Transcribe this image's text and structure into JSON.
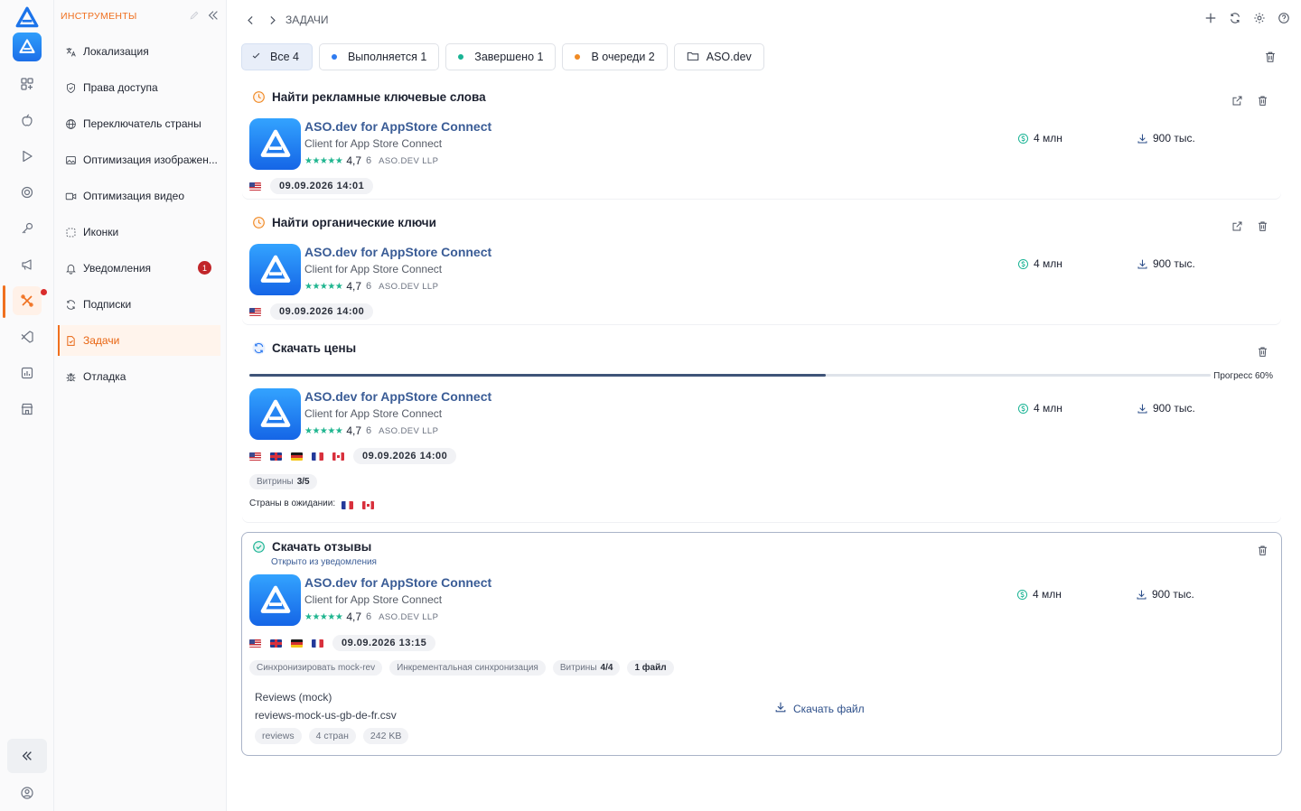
{
  "rail": {
    "icons": [
      "logo-icon",
      "app-logo-icon",
      "grid-icon",
      "apple-icon",
      "play-icon",
      "target-icon",
      "key-icon",
      "megaphone-icon",
      "tools-icon",
      "vscode-icon",
      "chart-icon",
      "store-icon"
    ],
    "active": "tools-icon",
    "bottom": [
      "collapse-icon",
      "user-icon"
    ]
  },
  "sidebar": {
    "title": "ИНСТРУМЕНТЫ",
    "items": [
      {
        "label": "Локализация",
        "icon": "translate-icon"
      },
      {
        "label": "Права доступа",
        "icon": "shield-icon"
      },
      {
        "label": "Переключатель страны",
        "icon": "globe-icon"
      },
      {
        "label": "Оптимизация изображен...",
        "icon": "image-icon"
      },
      {
        "label": "Оптимизация видео",
        "icon": "video-icon"
      },
      {
        "label": "Иконки",
        "icon": "icons-icon"
      },
      {
        "label": "Уведомления",
        "icon": "bell-icon",
        "badge": "1"
      },
      {
        "label": "Подписки",
        "icon": "refresh-icon"
      },
      {
        "label": "Задачи",
        "icon": "tasks-icon",
        "active": true
      },
      {
        "label": "Отладка",
        "icon": "bug-icon"
      }
    ]
  },
  "header": {
    "breadcrumb": "ЗАДАЧИ"
  },
  "filters": {
    "all": "Все 4",
    "running": "Выполняется 1",
    "done": "Завершено 1",
    "queued": "В очереди 2",
    "folder": "ASO.dev"
  },
  "colors": {
    "accent": "#f0701f",
    "running": "#2f7bf0",
    "done": "#19b394",
    "queued": "#f08a24",
    "app_name": "#3a5c96"
  },
  "app": {
    "name": "ASO.dev for AppStore Connect",
    "subtitle": "Client for App Store Connect",
    "stars": "★★★★★",
    "rating": "4,7",
    "rating_count": "6",
    "developer": "ASO.DEV LLP",
    "revenue": "4 млн",
    "downloads": "900 тыс."
  },
  "tasks": [
    {
      "title": "Найти рекламные ключевые слова",
      "status": "queued",
      "date": "09.09.2026 14:01"
    },
    {
      "title": "Найти органические ключи",
      "status": "queued",
      "date": "09.09.2026 14:00"
    },
    {
      "title": "Скачать цены",
      "status": "running",
      "progress": 0.6,
      "progress_label": "Прогресс 60%",
      "date": "09.09.2026 14:00",
      "storefronts_label": "Витрины",
      "storefronts_value": "3/5",
      "pending_label": "Страны в ожидании:"
    },
    {
      "title": "Скачать отзывы",
      "status": "done",
      "subtitle": "Открыто из уведомления",
      "date": "09.09.2026 13:15",
      "tags": [
        "Синхронизировать mock-rev",
        "Инкрементальная синхронизация"
      ],
      "storefronts_label": "Витрины",
      "storefronts_value": "4/4",
      "files_value": "1 файл",
      "file_kind": "Reviews (mock)",
      "file_name": "reviews-mock-us-gb-de-fr.csv",
      "file_tags": [
        "reviews",
        "4 стран",
        "242 KB"
      ],
      "download_label": "Скачать файл"
    }
  ]
}
